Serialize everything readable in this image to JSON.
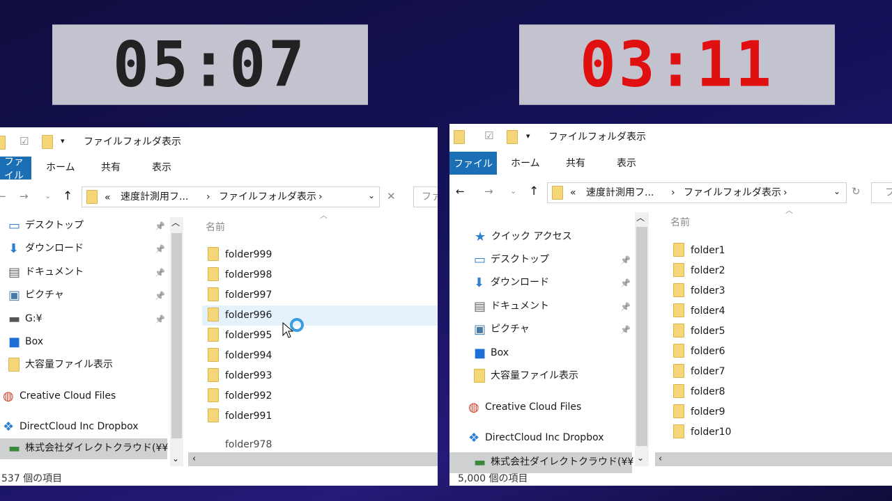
{
  "timers": {
    "left": "05:07",
    "right": "03:11",
    "left_color": "#222222",
    "right_color": "#e01010"
  },
  "left": {
    "title": "ファイルフォルダ表示",
    "tabs": [
      "ファイル",
      "ホーム",
      "共有",
      "表示"
    ],
    "breadcrumb": {
      "prefix": "«",
      "parent": "速度計測用フ...",
      "current": "ファイルフォルダ表示",
      "sep": "›"
    },
    "search_placeholder": "ファ",
    "nav": [
      "デスクトップ",
      "ダウンロード",
      "ドキュメント",
      "ピクチャ",
      "G:¥",
      "Box",
      "大容量ファイル表示",
      "Creative Cloud Files",
      "DirectCloud Inc Dropbox",
      "株式会社ダイレクトクラウド(¥¥"
    ],
    "column": "名前",
    "files": [
      "folder999",
      "folder998",
      "folder997",
      "folder996",
      "folder995",
      "folder994",
      "folder993",
      "folder992",
      "folder991",
      "folder998"
    ],
    "overlap_file": "folder978",
    "status": "537 個の項目"
  },
  "right": {
    "title": "ファイルフォルダ表示",
    "tabs": [
      "ファイル",
      "ホーム",
      "共有",
      "表示"
    ],
    "breadcrumb": {
      "prefix": "«",
      "parent": "速度計測用フ...",
      "current": "ファイルフォルダ表示",
      "sep": "›"
    },
    "search_placeholder": "フ",
    "nav": [
      "クイック アクセス",
      "デスクトップ",
      "ダウンロード",
      "ドキュメント",
      "ピクチャ",
      "Box",
      "大容量ファイル表示",
      "Creative Cloud Files",
      "DirectCloud Inc Dropbox",
      "株式会社ダイレクトクラウド(¥¥"
    ],
    "column": "名前",
    "files": [
      "folder1",
      "folder2",
      "folder3",
      "folder4",
      "folder5",
      "folder6",
      "folder7",
      "folder8",
      "folder9",
      "folder10"
    ],
    "status": "5,000 個の項目"
  },
  "colors": {
    "accent": "#1a6fb5",
    "selected_row": "#e5f1fb"
  }
}
